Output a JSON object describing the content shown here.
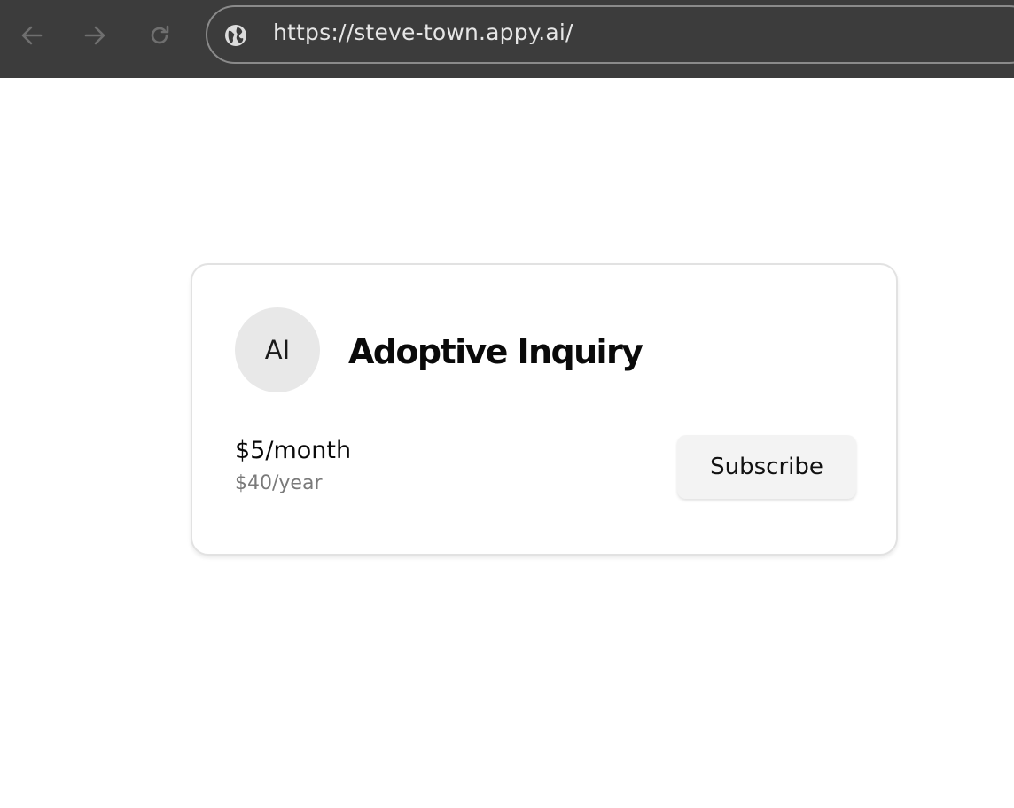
{
  "browser": {
    "url": "https://steve-town.appy.ai/",
    "icons": {
      "back": "arrow-left-icon",
      "forward": "arrow-right-icon",
      "reload": "reload-icon",
      "site": "globe-icon"
    },
    "colors": {
      "bar_background": "#3c3c3c",
      "url_text": "#e6e6e6"
    }
  },
  "card": {
    "avatar_initials": "AI",
    "title": "Adoptive Inquiry",
    "price_monthly": "$5/month",
    "price_yearly": "$40/year",
    "subscribe_label": "Subscribe"
  }
}
